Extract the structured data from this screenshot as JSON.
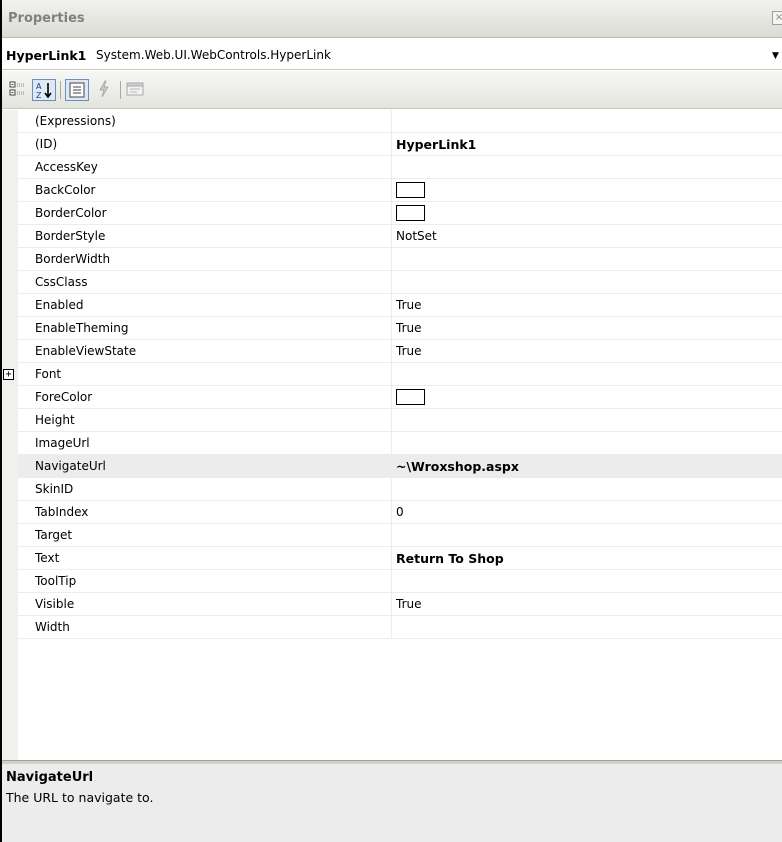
{
  "window": {
    "title": "Properties",
    "close_glyph": "×"
  },
  "selector": {
    "object_name": "HyperLink1",
    "object_type": "System.Web.UI.WebControls.HyperLink",
    "dropdown_glyph": "▼"
  },
  "toolbar": {
    "buttons": [
      {
        "icon": "categorized-icon",
        "selected": false
      },
      {
        "icon": "alphabetical-icon",
        "selected": true
      },
      {
        "icon": "properties-icon",
        "selected": true
      },
      {
        "icon": "events-lightning-icon",
        "selected": false
      },
      {
        "icon": "property-pages-icon",
        "selected": false
      }
    ]
  },
  "grid": {
    "selected_property": "NavigateUrl",
    "rows": [
      {
        "name": "(Expressions)",
        "value": "",
        "kind": "text"
      },
      {
        "name": "(ID)",
        "value": "HyperLink1",
        "kind": "bold"
      },
      {
        "name": "AccessKey",
        "value": "",
        "kind": "text"
      },
      {
        "name": "BackColor",
        "value": "",
        "kind": "swatch",
        "color": "#ffffff"
      },
      {
        "name": "BorderColor",
        "value": "",
        "kind": "swatch",
        "color": "#ffffff"
      },
      {
        "name": "BorderStyle",
        "value": "NotSet",
        "kind": "text"
      },
      {
        "name": "BorderWidth",
        "value": "",
        "kind": "text"
      },
      {
        "name": "CssClass",
        "value": "",
        "kind": "text"
      },
      {
        "name": "Enabled",
        "value": "True",
        "kind": "text"
      },
      {
        "name": "EnableTheming",
        "value": "True",
        "kind": "text"
      },
      {
        "name": "EnableViewState",
        "value": "True",
        "kind": "text"
      },
      {
        "name": "Font",
        "value": "",
        "kind": "text",
        "expandable": true,
        "expander_glyph": "+"
      },
      {
        "name": "ForeColor",
        "value": "",
        "kind": "swatch",
        "color": "#ffffff"
      },
      {
        "name": "Height",
        "value": "",
        "kind": "text"
      },
      {
        "name": "ImageUrl",
        "value": "",
        "kind": "text"
      },
      {
        "name": "NavigateUrl",
        "value": "~\\Wroxshop.aspx",
        "kind": "bold"
      },
      {
        "name": "SkinID",
        "value": "",
        "kind": "text"
      },
      {
        "name": "TabIndex",
        "value": "0",
        "kind": "text"
      },
      {
        "name": "Target",
        "value": "",
        "kind": "text"
      },
      {
        "name": "Text",
        "value": "Return To Shop",
        "kind": "bold"
      },
      {
        "name": "ToolTip",
        "value": "",
        "kind": "text"
      },
      {
        "name": "Visible",
        "value": "True",
        "kind": "text"
      },
      {
        "name": "Width",
        "value": "",
        "kind": "text"
      }
    ]
  },
  "description": {
    "title": "NavigateUrl",
    "text": "The URL to navigate to."
  },
  "colors": {
    "toolbar_selected_border": "#6b8dbf",
    "selected_row": "#ececec",
    "description_bg": "#ececec"
  }
}
